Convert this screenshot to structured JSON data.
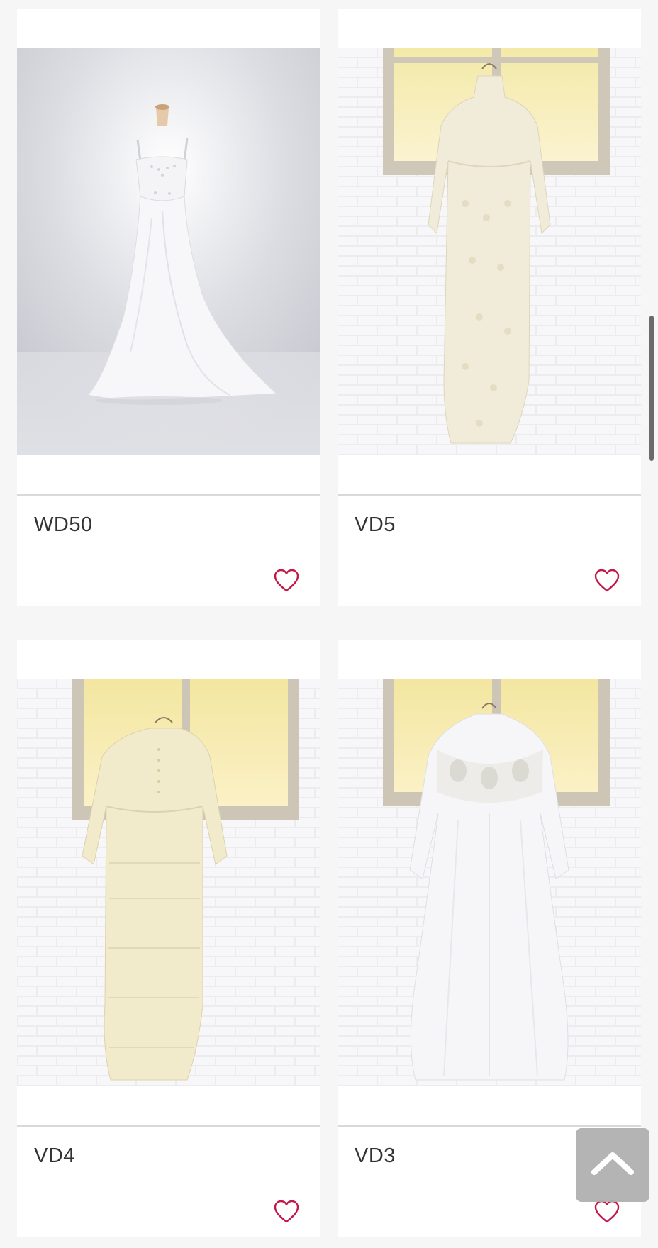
{
  "products": [
    {
      "code": "WD50",
      "favorite_icon": "heart-outline-icon"
    },
    {
      "code": "VD5",
      "favorite_icon": "heart-outline-icon"
    },
    {
      "code": "VD4",
      "favorite_icon": "heart-outline-icon"
    },
    {
      "code": "VD3",
      "favorite_icon": "heart-outline-icon"
    }
  ],
  "scroll_top_button": {
    "icon": "chevron-up-icon"
  },
  "colors": {
    "accent_heart": "#c0194a",
    "card_background": "#ffffff",
    "page_background": "#f6f6f6",
    "scroll_top_background": "#b0b0b0"
  }
}
